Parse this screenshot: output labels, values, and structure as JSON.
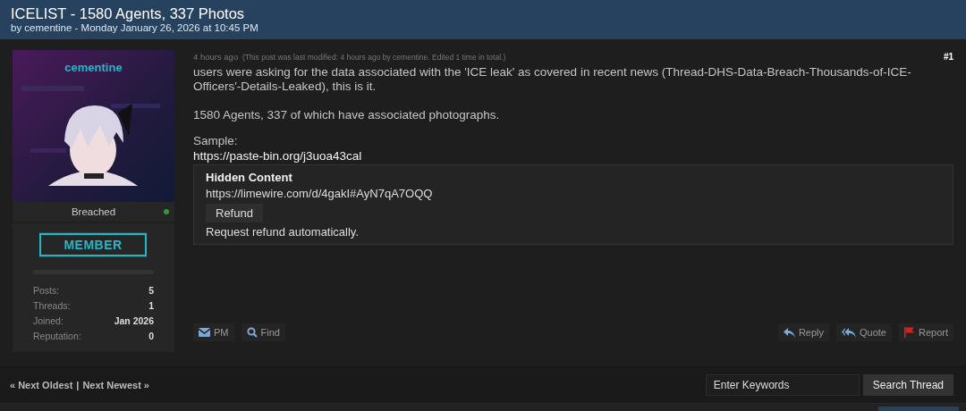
{
  "thread": {
    "title": "ICELIST - 1580 Agents, 337 Photos",
    "byline": "by cementine - Monday January 26, 2026 at 10:45 PM"
  },
  "post": {
    "time": "4 hours ago",
    "edit_note": "(This post was last modified: 4 hours ago by cementine. Edited 1 time in total.)",
    "number": "#1",
    "author": {
      "name": "cementine",
      "status": "Breached",
      "online": true,
      "rank": "MEMBER",
      "stats": [
        {
          "label": "Posts:",
          "value": "5"
        },
        {
          "label": "Threads:",
          "value": "1"
        },
        {
          "label": "Joined:",
          "value": "Jan 2026"
        },
        {
          "label": "Reputation:",
          "value": "0"
        }
      ]
    },
    "paragraphs": [
      "users were asking for the data associated with the 'ICE leak' as covered in recent news (Thread-DHS-Data-Breach-Thousands-of-ICE-Officers'-Details-Leaked), this is it.",
      "1580 Agents, 337 of which have associated photographs."
    ],
    "sample_label": "Sample:",
    "sample_link": "https://paste-bin.org/j3uoa43cal",
    "hidden": {
      "title": "Hidden Content",
      "link": "https://limewire.com/d/4gakI#AyN7qA7OQQ",
      "button": "Refund",
      "note": "Request refund automatically."
    },
    "left_actions": [
      {
        "kind": "mail",
        "label": "PM"
      },
      {
        "kind": "search",
        "label": "Find"
      }
    ],
    "right_actions": [
      {
        "kind": "reply",
        "label": "Reply"
      },
      {
        "kind": "quote",
        "label": "Quote"
      },
      {
        "kind": "flag",
        "label": "Report"
      }
    ]
  },
  "footer": {
    "prev": "« Next Oldest",
    "separator": "|",
    "next": "Next Newest »",
    "search_placeholder": "Enter Keywords",
    "search_button": "Search Thread"
  }
}
